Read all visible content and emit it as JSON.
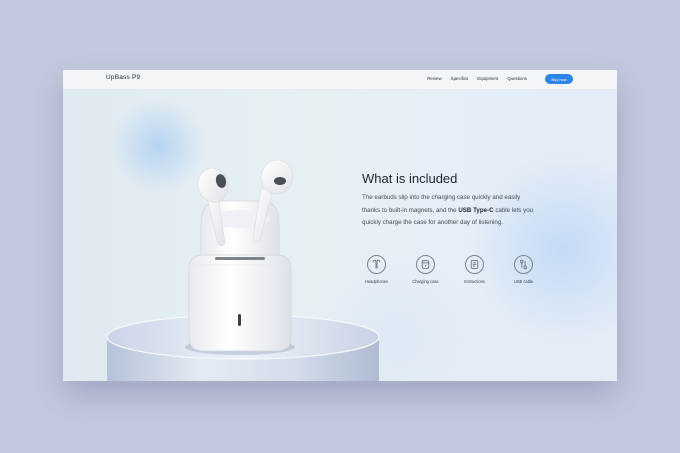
{
  "nav": {
    "logo": "UpBass P9",
    "links": [
      "Review",
      "Specifics",
      "Equipment",
      "Questions"
    ],
    "buy_label": "Buy now",
    "buy_color": "#2f84ea"
  },
  "hero": {
    "title": "What is included",
    "description": {
      "pre": "The earbuds slip into the charging case quickly and easily thanks to built-in magnets, and the ",
      "bold": "USB Type-C",
      "post": " cable lets you quickly charge the case for another day of listening."
    },
    "items": [
      {
        "label": "Headphones",
        "icon": "headphones-icon"
      },
      {
        "label": "Charging case",
        "icon": "charging-case-icon"
      },
      {
        "label": "Instructions",
        "icon": "instructions-icon"
      },
      {
        "label": "USB cable",
        "icon": "usb-cable-icon"
      }
    ]
  }
}
